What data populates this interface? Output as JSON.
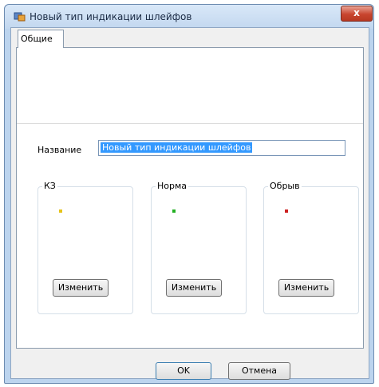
{
  "window": {
    "title": "Новый тип индикации шлейфов",
    "close_glyph": "x",
    "app_icon": "indication-app-icon"
  },
  "tabs": [
    {
      "label": "Общие",
      "active": true
    }
  ],
  "form": {
    "name_label": "Название",
    "name_value": "Новый тип индикации шлейфов"
  },
  "groups": [
    {
      "label": "КЗ",
      "color": "#e6c319",
      "button_label": "Изменить"
    },
    {
      "label": "Норма",
      "color": "#22b022",
      "button_label": "Изменить"
    },
    {
      "label": "Обрыв",
      "color": "#cc1f1f",
      "button_label": "Изменить"
    }
  ],
  "buttons": {
    "ok": "OK",
    "cancel": "Отмена"
  }
}
